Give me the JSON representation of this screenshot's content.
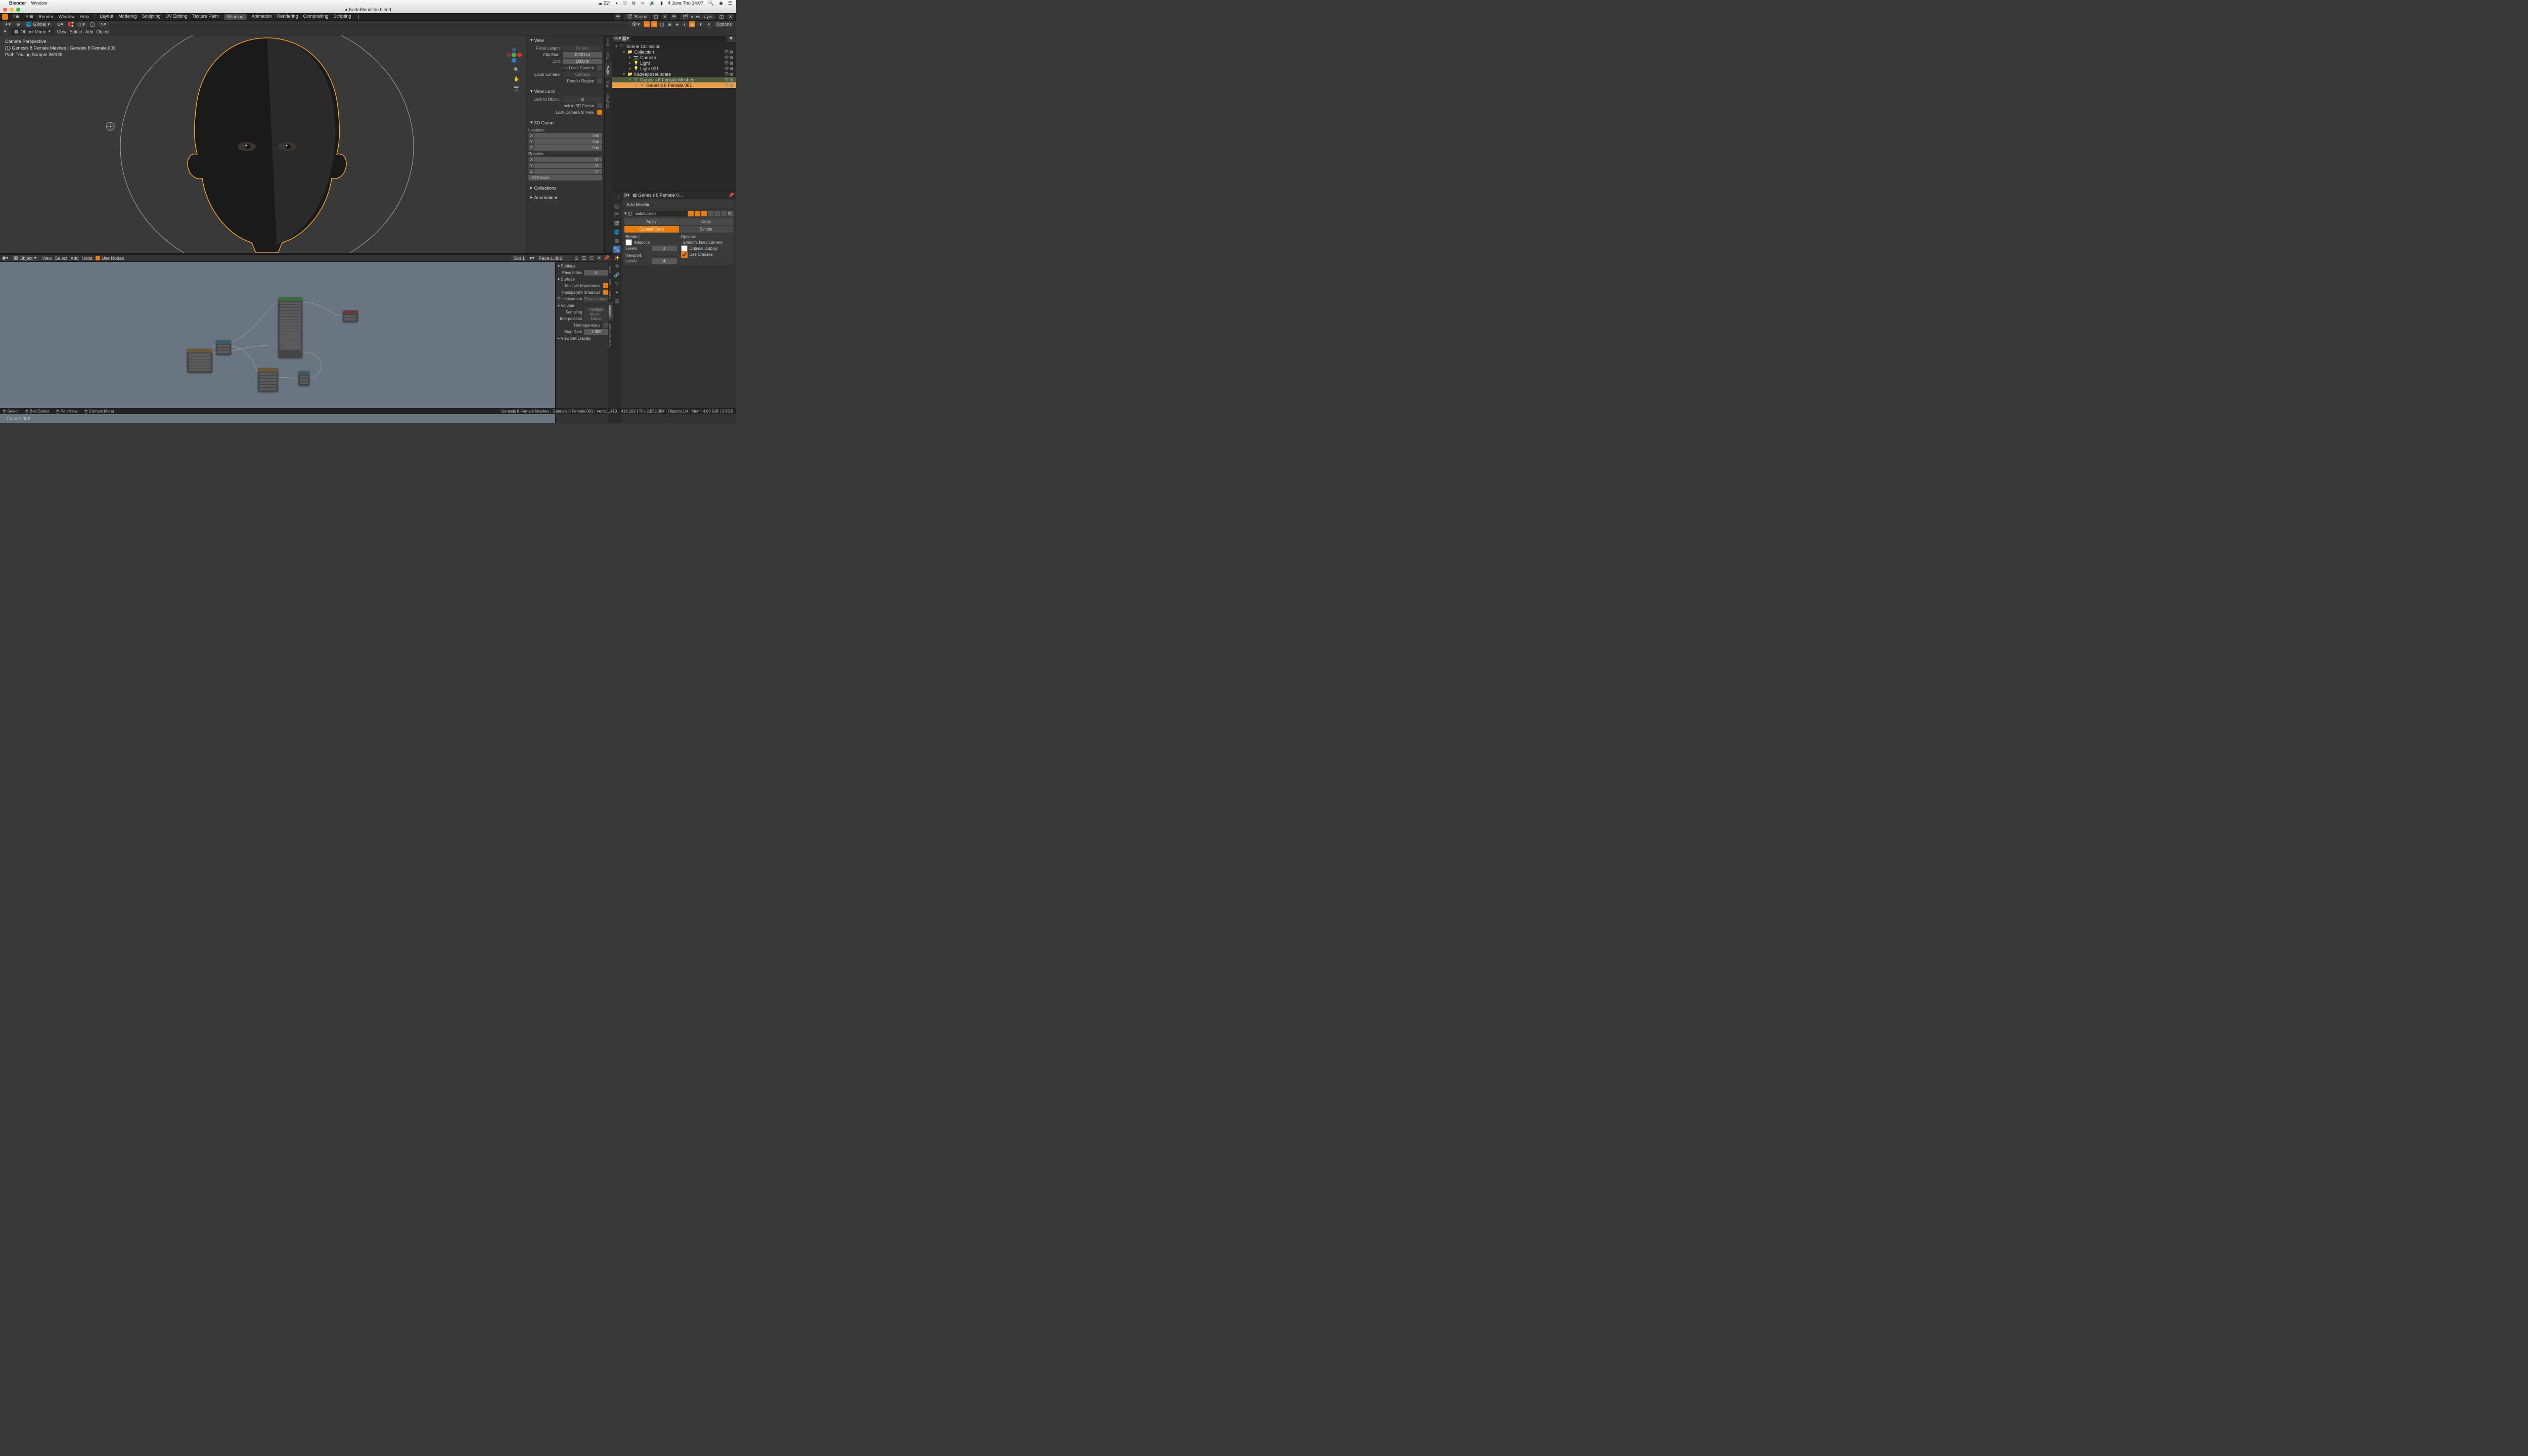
{
  "mac": {
    "app": "Blender",
    "menu2": "Window",
    "right": {
      "weather": "☁ 22°",
      "date": "4 June Thu 14:07"
    }
  },
  "doc": {
    "title": "● KadeBlendFile.blend"
  },
  "topbar": {
    "menus": [
      "File",
      "Edit",
      "Render",
      "Window",
      "Help"
    ],
    "workspaces": [
      "Layout",
      "Modeling",
      "Sculpting",
      "UV Editing",
      "Texture Paint",
      "Shading",
      "Animation",
      "Rendering",
      "Compositing",
      "Scripting"
    ],
    "active_ws": "Shading",
    "scene_label": "Scene",
    "layer_label": "View Layer"
  },
  "v3d_header": {
    "global": "Global",
    "options": "Options"
  },
  "v3d_mode": {
    "mode": "Object Mode",
    "menus": [
      "View",
      "Select",
      "Add",
      "Object"
    ]
  },
  "v3d_overlay": {
    "l1": "Camera Perspective",
    "l2": "(1) Genesis 8 Female Meshes | Genesis 8 Female.001",
    "l3": "Path Tracing Sample 36/128"
  },
  "npanel": {
    "tabs": [
      "Item",
      "Tool",
      "View",
      "Edit",
      "3D-Print"
    ],
    "view_hdr": "View",
    "focal": {
      "lbl": "Focal Length:",
      "val": "50 mm"
    },
    "clip_start": {
      "lbl": "Clip Start:",
      "val": "0.001 m"
    },
    "clip_end": {
      "lbl": "End:",
      "val": "1000 m"
    },
    "use_local_cam": "Use Local Camera",
    "local_cam": {
      "lbl": "Local Camera:",
      "val": "Camera"
    },
    "render_region": "Render Region",
    "viewlock_hdr": "View Lock",
    "lock_obj": "Lock to Object:",
    "lock_cursor": "Lock to 3D Cursor",
    "lock_cam": "Lock Camera to View",
    "cursor_hdr": "3D Cursor",
    "loc_lbl": "Location:",
    "rot_lbl": "Rotation:",
    "loc": {
      "x": "0 m",
      "y": "0 m",
      "z": "0 m"
    },
    "rot": {
      "x": "0°",
      "y": "0°",
      "z": "0°"
    },
    "rot_mode": "XYZ Euler",
    "collections_hdr": "Collections",
    "annotations_hdr": "Annotations"
  },
  "node_header": {
    "label": "Object",
    "menus": [
      "View",
      "Select",
      "Add",
      "Node"
    ],
    "use_nodes": "Use Nodes",
    "slot": "Slot 1",
    "mat": "Face-1.002",
    "users": "3"
  },
  "node_sidebar": {
    "settings": "Settings",
    "pass_idx": {
      "lbl": "Pass Index",
      "val": "0"
    },
    "surface": "Surface",
    "multi_imp": "Multiple Importance",
    "trans_shadow": "Transparent Shadows",
    "displacement": {
      "lbl": "Displacement",
      "val": "Displacement…"
    },
    "volume": "Volume",
    "sampling": {
      "lbl": "Sampling",
      "val": "Multiple Impo…"
    },
    "interp": {
      "lbl": "Interpolation",
      "val": "Linear"
    },
    "homo": "Homogeneous",
    "step": {
      "lbl": "Step Rate",
      "val": "1.000"
    },
    "vp_disp": "Viewport Display"
  },
  "node_footer": "Face-1.002",
  "outliner": {
    "root": "Scene Collection",
    "items": [
      {
        "depth": 1,
        "tw": "▾",
        "ic": "📁",
        "nm": "Collection"
      },
      {
        "depth": 2,
        "tw": "▸",
        "ic": "📷",
        "nm": "Camera"
      },
      {
        "depth": 2,
        "tw": "▸",
        "ic": "💡",
        "nm": "Light"
      },
      {
        "depth": 2,
        "tw": "▸",
        "ic": "💡",
        "nm": "Light.001"
      },
      {
        "depth": 1,
        "tw": "▾",
        "ic": "📁",
        "nm": "Kadeaposeupdate"
      },
      {
        "depth": 2,
        "tw": "▾",
        "ic": "▽",
        "nm": "Genesis 8 Female Meshes",
        "sel": true
      },
      {
        "depth": 3,
        "tw": "▸",
        "ic": "▽",
        "nm": "Genesis 8 Female.001",
        "active": true
      }
    ]
  },
  "props": {
    "crumb": "Genesis 8 Female 0…",
    "add_mod": "Add Modifier",
    "mod_name": "Subdivision",
    "apply": "Apply",
    "copy": "Copy",
    "catmull": "Catmull-Clark",
    "simple": "Simple",
    "render_lbl": "Render:",
    "options_lbl": "Options:",
    "adaptive": "Adaptive",
    "levels1": {
      "lbl": "Levels",
      "val": "3"
    },
    "smooth": "Smooth, keep corners",
    "opt_disp": "Optimal Display",
    "use_creases": "Use Creases",
    "viewport_lbl": "Viewport:",
    "levels2": {
      "lbl": "Levels",
      "val": "4"
    }
  },
  "status": {
    "select": "Select",
    "box": "Box Select",
    "pan": "Pan View",
    "ctx": "Context Menu",
    "right": "Genesis 8 Female Meshes | Genesis 8 Female.001 | Verts:1,419…416,192 | Tris:2,832,384 | Objects:1/4 | Mem: 4.69 GiB | 2.83.0"
  }
}
